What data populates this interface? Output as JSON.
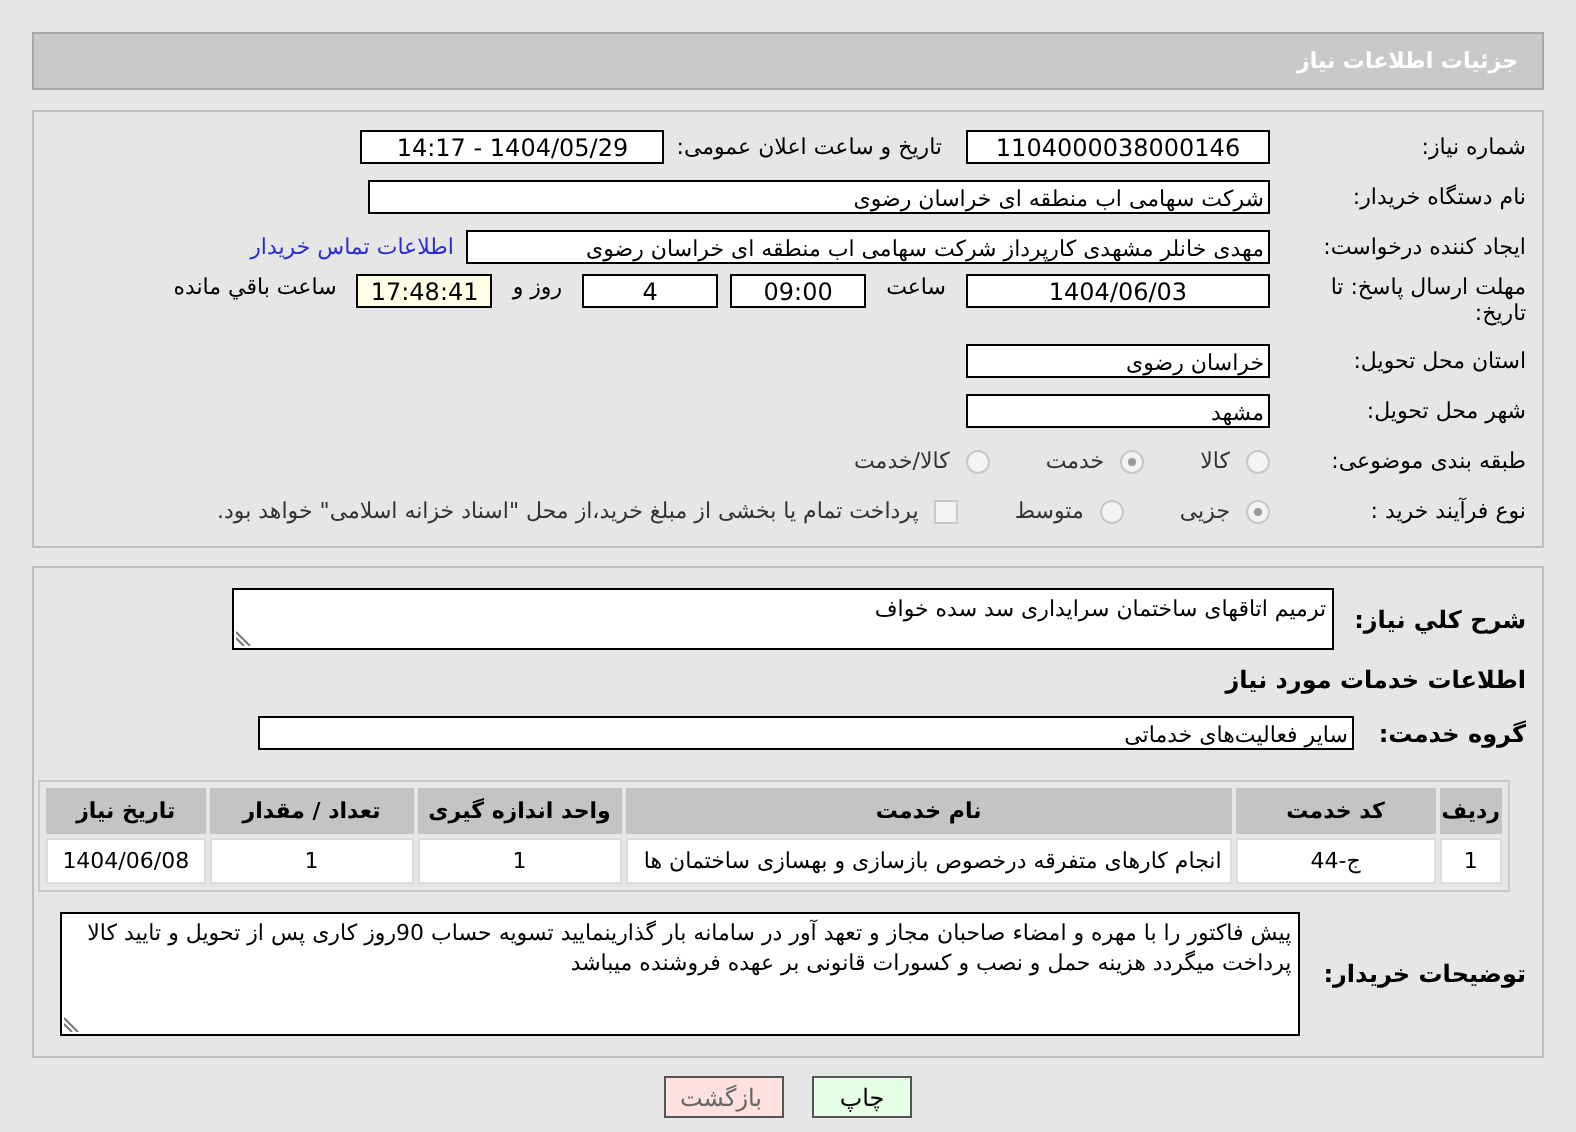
{
  "header": {
    "title": "جزئیات اطلاعات نیاز"
  },
  "fields": {
    "need_number": {
      "label": "شماره نیاز:",
      "value": "1104000038000146"
    },
    "announce": {
      "label": "تاریخ و ساعت اعلان عمومی:",
      "value": "1404/05/29 - 14:17"
    },
    "buyer": {
      "label": "نام دستگاه خریدار:",
      "value": "شرکت سهامی اب منطقه ای خراسان رضوی"
    },
    "creator": {
      "label": "ایجاد کننده درخواست:",
      "value": "مهدی خانلر مشهدی کارپرداز شرکت سهامی اب منطقه ای خراسان رضوی",
      "link": "اطلاعات تماس خریدار"
    },
    "deadline": {
      "label": "مهلت ارسال پاسخ: تا تاریخ:",
      "date": "1404/06/03",
      "time_label": "ساعت",
      "time": "09:00",
      "days": "4",
      "days_label": "روز و",
      "remaining": "17:48:41",
      "remaining_label": "ساعت باقي مانده"
    },
    "province": {
      "label": "استان محل تحویل:",
      "value": "خراسان رضوی"
    },
    "city": {
      "label": "شهر محل تحویل:",
      "value": "مشهد"
    }
  },
  "category": {
    "label": "طبقه بندی موضوعی:",
    "options": [
      {
        "label": "کالا",
        "selected": false
      },
      {
        "label": "خدمت",
        "selected": true
      },
      {
        "label": "کالا/خدمت",
        "selected": false
      }
    ]
  },
  "purchase_type": {
    "label": "نوع فرآیند خرید :",
    "options": [
      {
        "label": "جزیی",
        "selected": true
      },
      {
        "label": "متوسط",
        "selected": false
      }
    ],
    "payment": {
      "label": "پرداخت تمام یا بخشی از مبلغ خرید،از محل \"اسناد خزانه اسلامی\" خواهد بود.",
      "checked": false
    }
  },
  "summary": {
    "label": "شرح کلي نیاز:",
    "value": "ترمیم اتاقهای ساختمان سرایداری سد سده خواف"
  },
  "services_heading": "اطلاعات خدمات مورد نیاز",
  "service_group": {
    "label": "گروه خدمت:",
    "value": "سایر فعالیت‌های خدماتی"
  },
  "table": {
    "columns": [
      "ردیف",
      "کد خدمت",
      "نام خدمت",
      "واحد اندازه گیری",
      "تعداد / مقدار",
      "تاریخ نیاز"
    ],
    "rows": [
      [
        "1",
        "ج-44",
        "انجام کارهای متفرقه درخصوص بازسازی و بهسازی ساختمان ها",
        "1",
        "1",
        "1404/06/08"
      ]
    ]
  },
  "buyer_notes": {
    "label": "توضیحات خریدار:",
    "value": "پیش فاکتور را با مهره و امضاء صاحبان مجاز و تعهد آور در سامانه بار گذارینمایید تسویه حساب 90روز کاری پس از تحویل و تایید کالا پرداخت میگردد هزینه حمل و نصب و کسورات قانونی بر عهده فروشنده میباشد"
  },
  "buttons": [
    {
      "label": "چاپ",
      "kind": "print"
    },
    {
      "label": "بازگشت",
      "kind": "back"
    }
  ]
}
